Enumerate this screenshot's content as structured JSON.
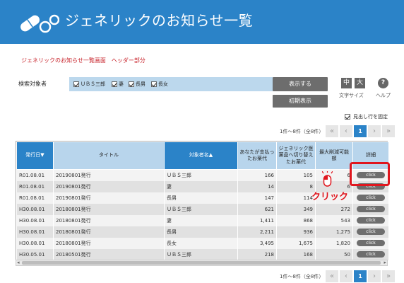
{
  "header": {
    "title": "ジェネリックのお知らせ一覧"
  },
  "breadcrumb": "ジェネリックのお知らせ一覧画面　ヘッダー部分",
  "search": {
    "label": "検索対象者",
    "targets": [
      {
        "label": "ＵＢＳ三郎",
        "checked": true
      },
      {
        "label": "妻",
        "checked": true
      },
      {
        "label": "長男",
        "checked": true
      },
      {
        "label": "長女",
        "checked": true
      }
    ],
    "show_button": "表示する",
    "reset_button": "初期表示"
  },
  "text_size": {
    "medium": "中",
    "large": "大",
    "label": "文字サイズ"
  },
  "help": {
    "icon_text": "?",
    "label": "ヘルプ"
  },
  "fix_header": {
    "label": "見出し行を固定",
    "checked": true
  },
  "pagination": {
    "count_text": "1件～8件（全8件）",
    "first": "«",
    "prev": "‹",
    "current": "1",
    "next": "›",
    "last": "»"
  },
  "table": {
    "headers": {
      "date": "発行日▼",
      "title": "タイトル",
      "target": "対象者名▲",
      "paid": "あなたが支払ったお薬代",
      "generic_paid": "ジェネリック医薬品へ切り替えたお薬代",
      "max_saving": "最大削減可能額",
      "detail": "詳細"
    },
    "rows": [
      {
        "date": "R01.08.01",
        "title": "20190801発行",
        "target": "ＵＢＳ三郎",
        "paid": "166",
        "generic": "105",
        "saving": "6",
        "detail": "click"
      },
      {
        "date": "R01.08.01",
        "title": "20190801発行",
        "target": "妻",
        "paid": "14",
        "generic": "8",
        "saving": "6",
        "detail": "click"
      },
      {
        "date": "R01.08.01",
        "title": "20190801発行",
        "target": "長男",
        "paid": "147",
        "generic": "114",
        "saving": "",
        "detail": "click"
      },
      {
        "date": "H30.08.01",
        "title": "20180801発行",
        "target": "ＵＢＳ三郎",
        "paid": "621",
        "generic": "349",
        "saving": "272",
        "detail": "click"
      },
      {
        "date": "H30.08.01",
        "title": "20180801発行",
        "target": "妻",
        "paid": "1,411",
        "generic": "868",
        "saving": "543",
        "detail": "click"
      },
      {
        "date": "H30.08.01",
        "title": "20180801発行",
        "target": "長男",
        "paid": "2,211",
        "generic": "936",
        "saving": "1,275",
        "detail": "click"
      },
      {
        "date": "H30.08.01",
        "title": "20180801発行",
        "target": "長女",
        "paid": "3,495",
        "generic": "1,675",
        "saving": "1,820",
        "detail": "click"
      },
      {
        "date": "H30.05.01",
        "title": "20180501発行",
        "target": "ＵＢＳ三郎",
        "paid": "218",
        "generic": "168",
        "saving": "50",
        "detail": "click"
      }
    ]
  },
  "annotation": {
    "click_label": "クリック"
  },
  "colors": {
    "brand_blue": "#2b83c8",
    "highlight_red": "#e0161e"
  }
}
